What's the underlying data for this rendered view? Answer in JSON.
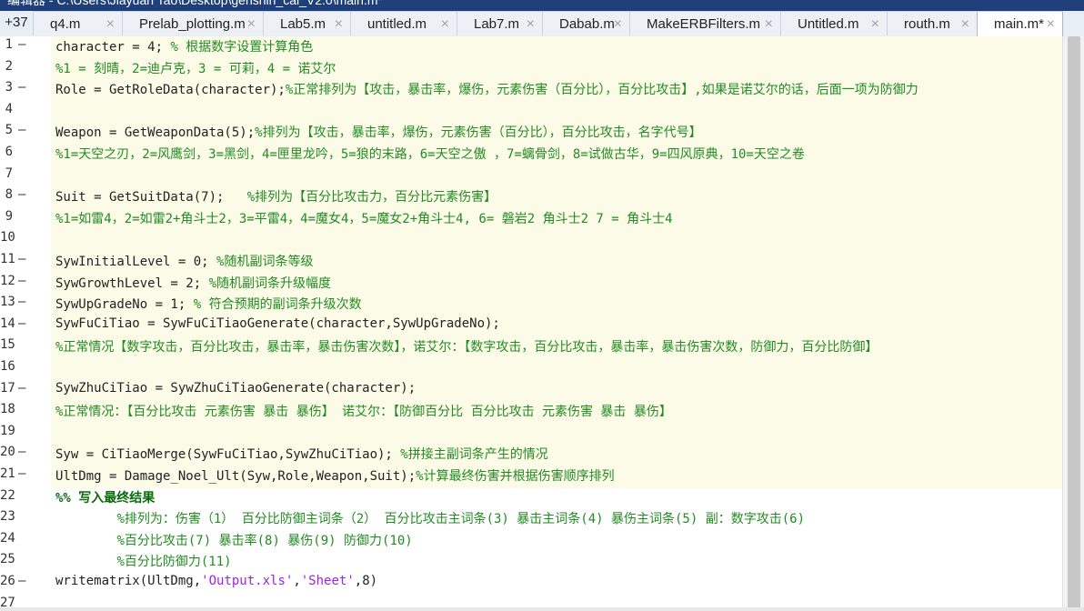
{
  "window": {
    "title": "编辑器 - C:\\Users\\Jiayuan Tao\\Desktop\\genshin_cal_V2.0\\main.m*"
  },
  "tabbar": {
    "overflow_count": "+37",
    "tabs": [
      {
        "label": "q4.m"
      },
      {
        "label": "Prelab_plotting.m"
      },
      {
        "label": "Lab5.m"
      },
      {
        "label": "untitled.m"
      },
      {
        "label": "Lab7.m"
      },
      {
        "label": "Dabab.m"
      },
      {
        "label": "MakeERBFilters.m"
      },
      {
        "label": "Untitled.m"
      },
      {
        "label": "routh.m"
      },
      {
        "label": "main.m*"
      }
    ],
    "close_glyph": "×"
  },
  "editor": {
    "lines": [
      {
        "num": "1",
        "mark": "—",
        "text": "character = 4; % 根据数字设置计算角色"
      },
      {
        "num": "2",
        "mark": "",
        "text": "%1 = 刻晴，2=迪卢克，3 = 可莉，4 = 诺艾尔"
      },
      {
        "num": "3",
        "mark": "—",
        "text": "Role = GetRoleData(character);%正常排列为【攻击，暴击率，爆伤，元素伤害（百分比），百分比攻击】,如果是诺艾尔的话，后面一项为防御力"
      },
      {
        "num": "4",
        "mark": "",
        "text": ""
      },
      {
        "num": "5",
        "mark": "—",
        "text": "Weapon = GetWeaponData(5);%排列为【攻击，暴击率，爆伤，元素伤害（百分比），百分比攻击，名字代号】"
      },
      {
        "num": "6",
        "mark": "",
        "text": "%1=天空之刃，2=风鹰剑，3=黑剑，4=匣里龙吟，5=狼的末路，6=天空之傲 ，7=螭骨剑，8=试做古华，9=四风原典，10=天空之卷"
      },
      {
        "num": "7",
        "mark": "",
        "text": ""
      },
      {
        "num": "8",
        "mark": "—",
        "text": "Suit = GetSuitData(7);   %排列为【百分比攻击力，百分比元素伤害】"
      },
      {
        "num": "9",
        "mark": "",
        "text": "%1=如雷4，2=如雷2+角斗士2，3=平雷4，4=魔女4，5=魔女2+角斗士4, 6= 磐岩2 角斗士2 7 = 角斗士4"
      },
      {
        "num": "10",
        "mark": "",
        "text": ""
      },
      {
        "num": "11",
        "mark": "—",
        "text": "SywInitialLevel = 0; %随机副词条等级"
      },
      {
        "num": "12",
        "mark": "—",
        "text": "SywGrowthLevel = 2; %随机副词条升级幅度"
      },
      {
        "num": "13",
        "mark": "—",
        "text": "SywUpGradeNo = 1; % 符合预期的副词条升级次数"
      },
      {
        "num": "14",
        "mark": "—",
        "text": "SywFuCiTiao = SywFuCiTiaoGenerate(character,SywUpGradeNo);"
      },
      {
        "num": "15",
        "mark": "",
        "text": "%正常情况【数字攻击，百分比攻击，暴击率，暴击伤害次数】，诺艾尔：【数字攻击，百分比攻击，暴击率，暴击伤害次数，防御力，百分比防御】"
      },
      {
        "num": "16",
        "mark": "",
        "text": ""
      },
      {
        "num": "17",
        "mark": "—",
        "text": "SywZhuCiTiao = SywZhuCiTiaoGenerate(character);"
      },
      {
        "num": "18",
        "mark": "",
        "text": "%正常情况：【百分比攻击 元素伤害 暴击 暴伤】 诺艾尔：【防御百分比 百分比攻击 元素伤害 暴击 暴伤】"
      },
      {
        "num": "19",
        "mark": "",
        "text": ""
      },
      {
        "num": "20",
        "mark": "—",
        "text": "Syw = CiTiaoMerge(SywFuCiTiao,SywZhuCiTiao); %拼接主副词条产生的情况"
      },
      {
        "num": "21",
        "mark": "—",
        "text": "UltDmg = Damage_Noel_Ult(Syw,Role,Weapon,Suit);%计算最终伤害并根据伤害顺序排列"
      },
      {
        "num": "22",
        "mark": "",
        "text": "%% 写入最终结果"
      },
      {
        "num": "23",
        "mark": "",
        "text": "        %排列为：伤害（1） 百分比防御主词条（2） 百分比攻击主词条(3) 暴击主词条(4) 暴伤主词条(5) 副：数字攻击(6)"
      },
      {
        "num": "24",
        "mark": "",
        "text": "        %百分比攻击(7) 暴击率(8) 暴伤(9) 防御力(10)"
      },
      {
        "num": "25",
        "mark": "",
        "text": "        %百分比防御力(11)"
      },
      {
        "num": "26",
        "mark": "—",
        "text": "writematrix(UltDmg,'Output.xls','Sheet',8)"
      },
      {
        "num": "27",
        "mark": "",
        "text": ""
      }
    ]
  },
  "colors": {
    "code": "#222222",
    "comment": "#228b22",
    "string": "#a020f0",
    "cell_title": "#0b6b0b",
    "highlight": "#fbfbe8",
    "titlebar": "#1f3f7a"
  }
}
